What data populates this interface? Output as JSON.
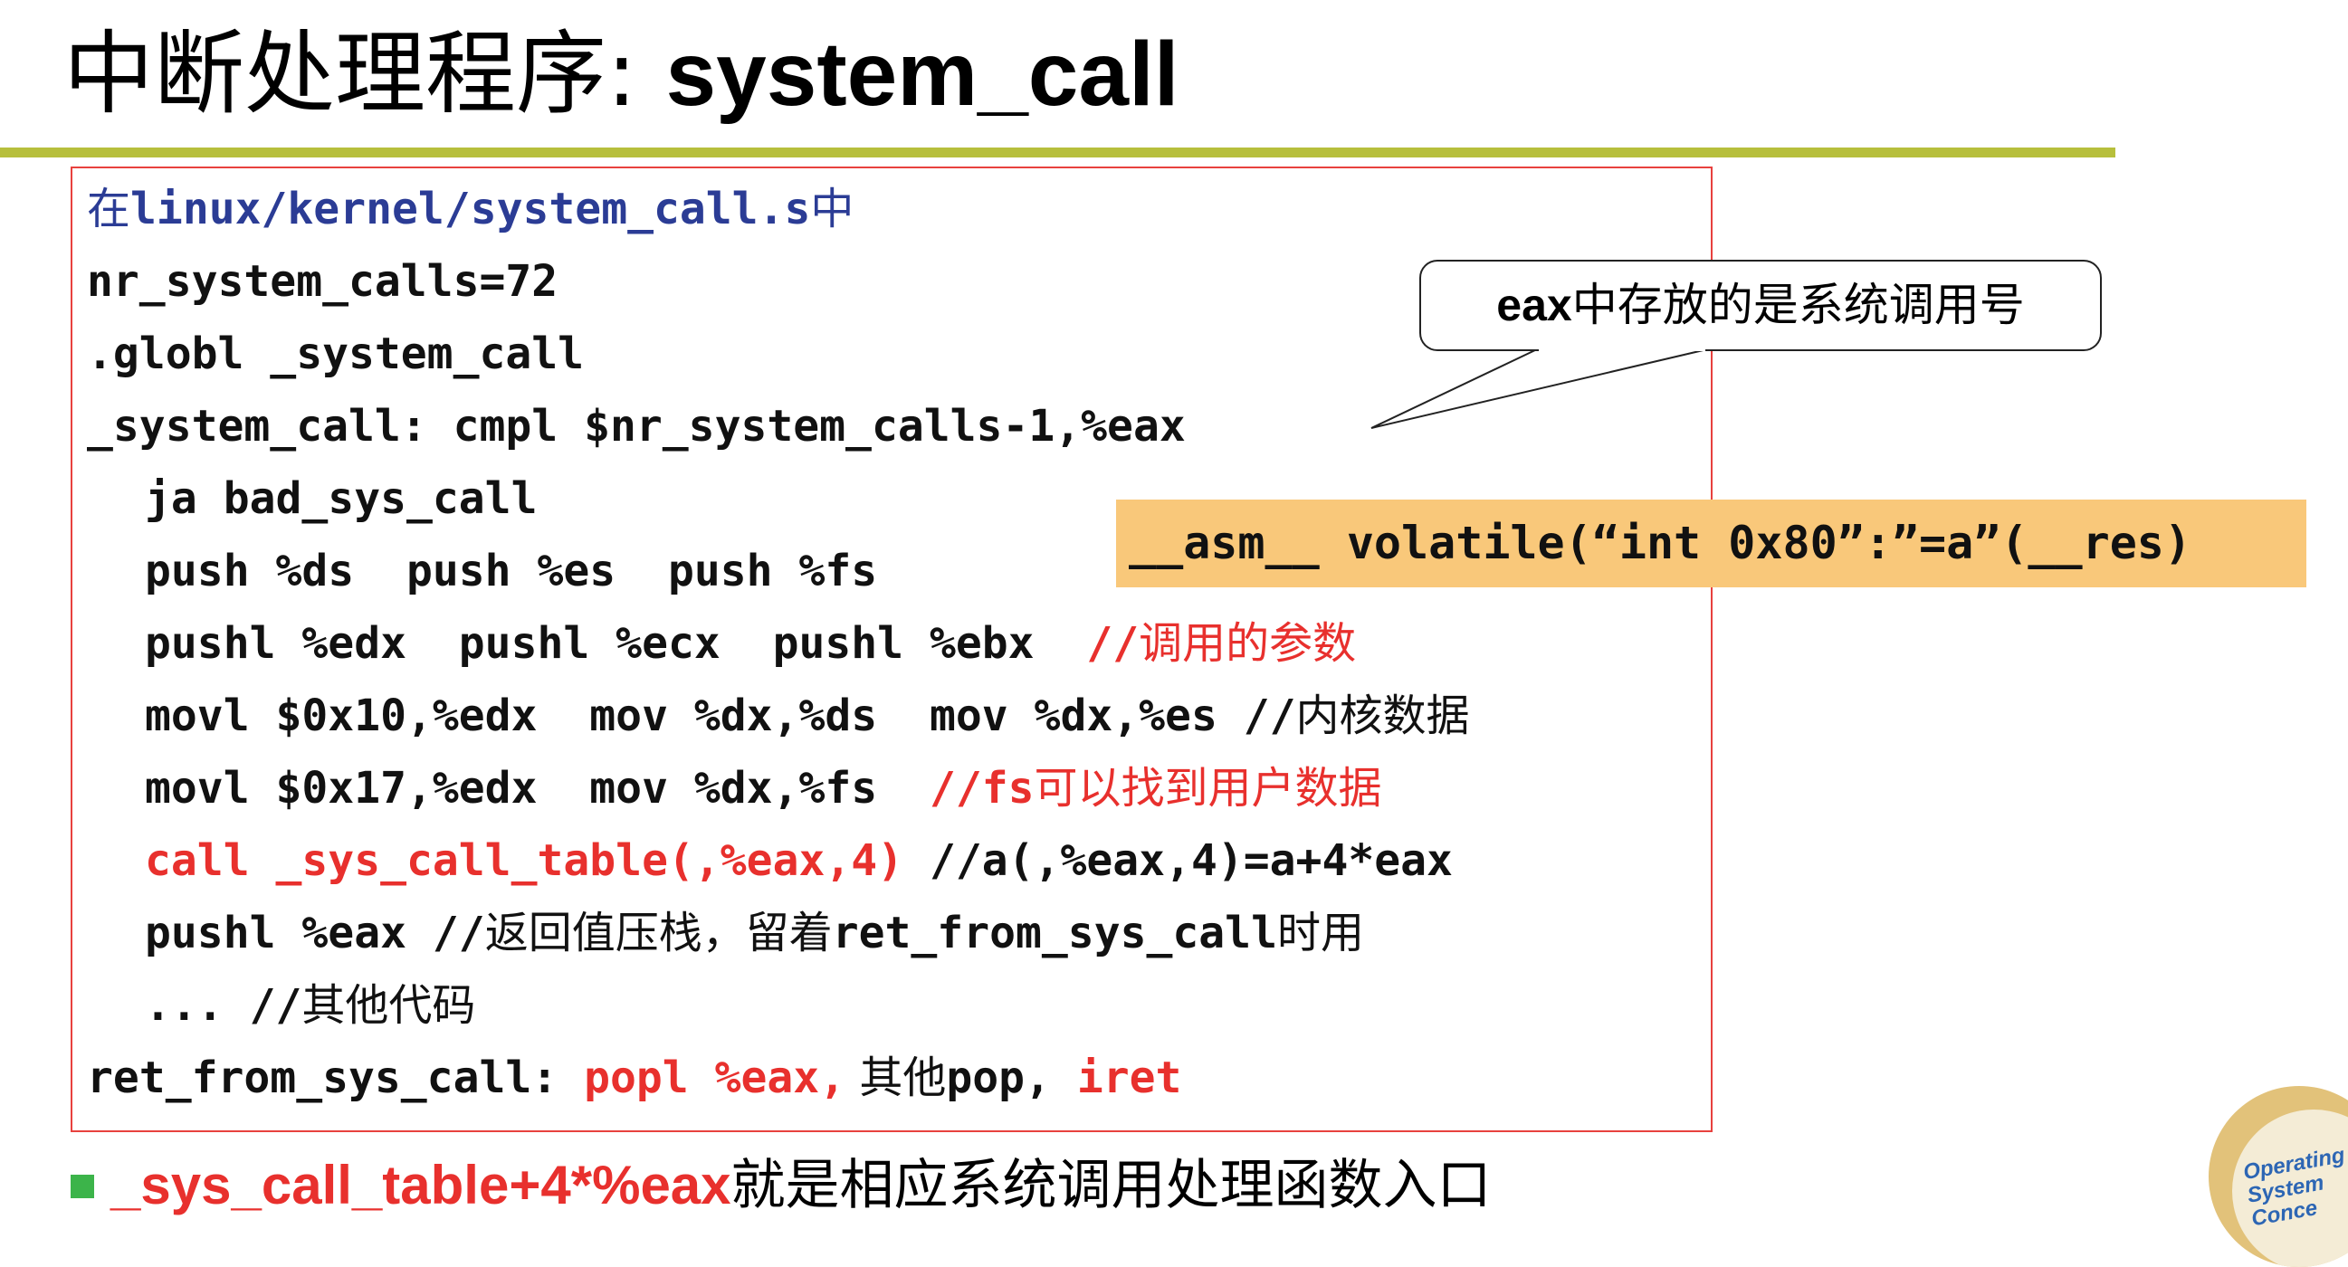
{
  "slide": {
    "title_cn": "中断处理程序: ",
    "title_en": "system_call"
  },
  "code": {
    "file_prefix": "在",
    "file_path": "linux/kernel/system_call.s",
    "file_suffix": "中",
    "l1": "nr_system_calls=72",
    "l2": ".globl _system_call",
    "l3": "_system_call: cmpl $nr_system_calls-1,%eax",
    "l4": "ja bad_sys_call",
    "l5": "push %ds  push %es  push %fs",
    "l6_code": "pushl %edx  pushl %ecx  pushl %ebx  ",
    "l6_comment_slash": "//",
    "l6_comment_cn": "调用的参数",
    "l7_code": "movl $0x10,%edx  mov %dx,%ds  mov %dx,%es //",
    "l7_comment_cn": "内核数据",
    "l8_code": "movl $0x17,%edx  mov %dx,%fs  ",
    "l8_comment_code": "//fs",
    "l8_comment_cn": "可以找到用户数据",
    "l9_red": "call _sys_call_table(,%eax,4)",
    "l9_comment": " //a(,%eax,4)=a+4*eax",
    "l10_code": "pushl %eax //",
    "l10_cn1": "返回值压栈，留着",
    "l10_code2": "ret_from_sys_call",
    "l10_cn2": "时用",
    "l11_code": "... //",
    "l11_cn": "其他代码",
    "l12_code": "ret_from_sys_call: ",
    "l12_red1": "popl %eax,",
    "l12_cn": " 其他",
    "l12_code2": "pop, ",
    "l12_red2": "iret"
  },
  "callout": {
    "en": "eax",
    "cn": "中存放的是系统调用号"
  },
  "asm_box": {
    "text": "__asm__ volatile(“int 0x80”:”=a”(__res)"
  },
  "bullet": {
    "red": "_sys_call_table+4*%eax",
    "text": "就是相应系统调用处理函数入口"
  },
  "logo": {
    "line1": "Operating",
    "line2": "System",
    "line3": "Conce"
  },
  "colors": {
    "rule": "#b7bf3c",
    "code_border": "#e8413e",
    "red_text": "#e8302d",
    "blue_text": "#2b3c95",
    "asm_bg": "#f9c87a",
    "bullet": "#3cb44a"
  }
}
